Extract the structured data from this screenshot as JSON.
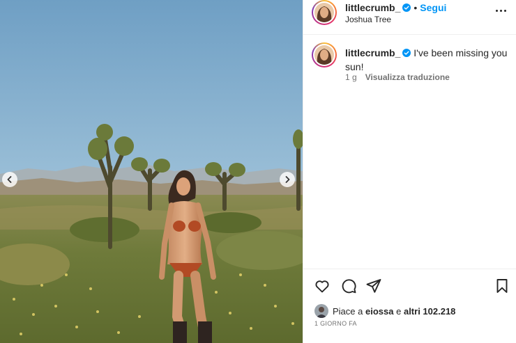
{
  "post": {
    "username": "littlecrumb_",
    "separator": "•",
    "follow_label": "Segui",
    "location": "Joshua Tree"
  },
  "caption": {
    "username": "littlecrumb_",
    "text": "I've been missing you sun!",
    "age": "1 g",
    "translate_label": "Visualizza traduzione"
  },
  "likes": {
    "prefix": "Piace a ",
    "liker": "eiossa",
    "middle": " e ",
    "others": "altri 102.218"
  },
  "time_label": "1 GIORNO FA",
  "colors": {
    "accent_blue": "#0095f6",
    "verified_blue": "#0095f6",
    "text_primary": "#262626",
    "text_secondary": "#737373"
  },
  "icons": {
    "like": "heart-outline-icon",
    "comment": "comment-bubble-icon",
    "share": "paper-plane-icon",
    "save": "bookmark-icon",
    "more": "more-options-icon",
    "verified": "verified-badge-icon",
    "prev": "chevron-left-icon",
    "next": "chevron-right-icon"
  }
}
